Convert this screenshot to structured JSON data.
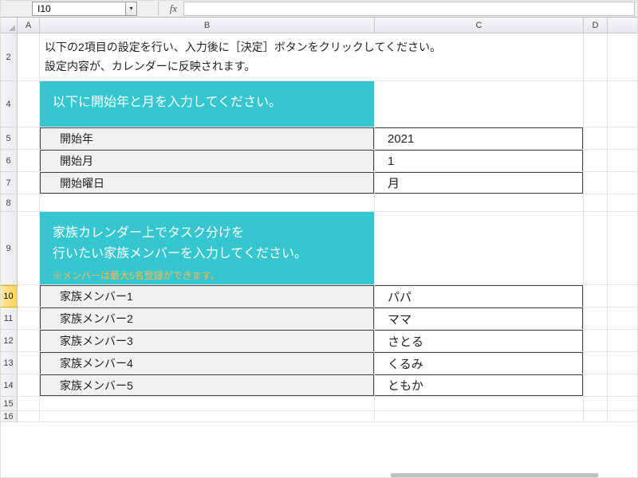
{
  "namebox": {
    "value": "I10"
  },
  "fx_label": "fx",
  "columns": {
    "A": "A",
    "B": "B",
    "C": "C",
    "D": "D"
  },
  "rows": [
    "2",
    "4",
    "5",
    "6",
    "7",
    "8",
    "9",
    "10",
    "11",
    "12",
    "13",
    "14",
    "15",
    "16"
  ],
  "instructions": {
    "line1": "以下の2項目の設定を行い、入力後に［決定］ボタンをクリックしてください。",
    "line2": "設定内容が、カレンダーに反映されます。"
  },
  "section1": {
    "heading": "以下に開始年と月を入力してください。",
    "rows": [
      {
        "label": "開始年",
        "value": "2021"
      },
      {
        "label": "開始月",
        "value": "1"
      },
      {
        "label": "開始曜日",
        "value": "月"
      }
    ]
  },
  "section2": {
    "heading_line1": "家族カレンダー上でタスク分けを",
    "heading_line2": "行いたい家族メンバーを入力してください。",
    "note": "※メンバーは最大5名登録ができます。",
    "rows": [
      {
        "label": "家族メンバー1",
        "value": "パパ"
      },
      {
        "label": "家族メンバー2",
        "value": "ママ"
      },
      {
        "label": "家族メンバー3",
        "value": "さとる"
      },
      {
        "label": "家族メンバー4",
        "value": "くるみ"
      },
      {
        "label": "家族メンバー5",
        "value": "ともか"
      }
    ]
  },
  "active_row": "10"
}
